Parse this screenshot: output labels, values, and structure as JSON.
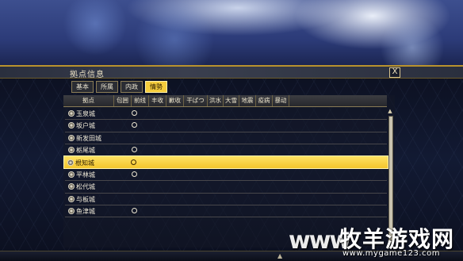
{
  "window": {
    "title": "拠点信息",
    "close_label": "X"
  },
  "tabs": [
    {
      "label": "基本",
      "active": false
    },
    {
      "label": "所属",
      "active": false
    },
    {
      "label": "内政",
      "active": false
    },
    {
      "label": "情勢",
      "active": true
    }
  ],
  "table": {
    "columns": [
      "拠点",
      "包囲",
      "前线",
      "丰收",
      "歉收",
      "干ばつ",
      "洪水",
      "大雪",
      "地震",
      "疫病",
      "暴动"
    ],
    "rows": [
      {
        "name": "玉泉城",
        "frontline": "○",
        "highlight": false
      },
      {
        "name": "坂户城",
        "frontline": "○",
        "highlight": false
      },
      {
        "name": "新发田城",
        "frontline": "",
        "highlight": false
      },
      {
        "name": "栃尾城",
        "frontline": "○",
        "highlight": false
      },
      {
        "name": "根知城",
        "frontline": "○",
        "highlight": true
      },
      {
        "name": "平林城",
        "frontline": "○",
        "highlight": false
      },
      {
        "name": "松代城",
        "frontline": "",
        "highlight": false
      },
      {
        "name": "与板城",
        "frontline": "",
        "highlight": false
      },
      {
        "name": "鱼津城",
        "frontline": "○",
        "highlight": false
      }
    ]
  },
  "colors": {
    "accent_gold": "#f4cc3c",
    "panel_border": "#b8922e"
  },
  "watermark": {
    "prefix": "www",
    "site_name": "牧羊游戏网",
    "url": "www.mygame123.com"
  }
}
